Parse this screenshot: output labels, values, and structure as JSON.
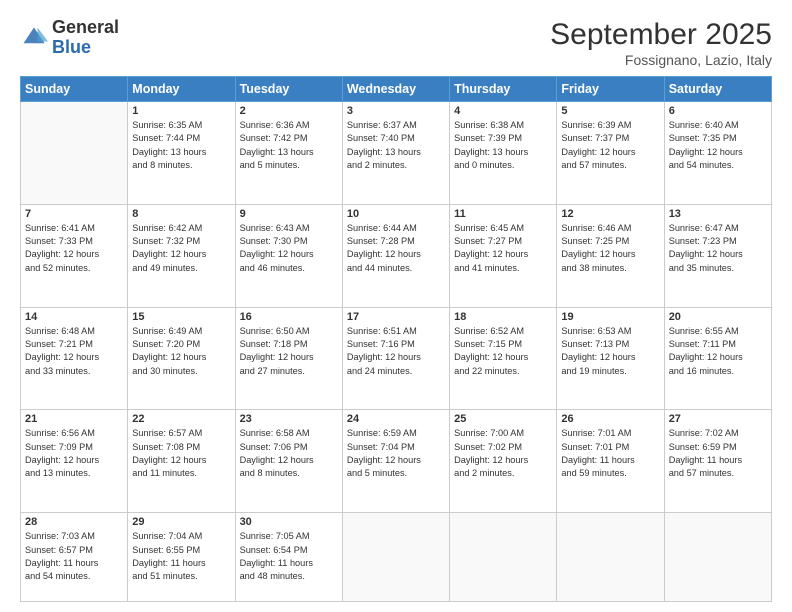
{
  "logo": {
    "general": "General",
    "blue": "Blue"
  },
  "title": "September 2025",
  "location": "Fossignano, Lazio, Italy",
  "days_of_week": [
    "Sunday",
    "Monday",
    "Tuesday",
    "Wednesday",
    "Thursday",
    "Friday",
    "Saturday"
  ],
  "weeks": [
    [
      {
        "day": "",
        "info": ""
      },
      {
        "day": "1",
        "info": "Sunrise: 6:35 AM\nSunset: 7:44 PM\nDaylight: 13 hours\nand 8 minutes."
      },
      {
        "day": "2",
        "info": "Sunrise: 6:36 AM\nSunset: 7:42 PM\nDaylight: 13 hours\nand 5 minutes."
      },
      {
        "day": "3",
        "info": "Sunrise: 6:37 AM\nSunset: 7:40 PM\nDaylight: 13 hours\nand 2 minutes."
      },
      {
        "day": "4",
        "info": "Sunrise: 6:38 AM\nSunset: 7:39 PM\nDaylight: 13 hours\nand 0 minutes."
      },
      {
        "day": "5",
        "info": "Sunrise: 6:39 AM\nSunset: 7:37 PM\nDaylight: 12 hours\nand 57 minutes."
      },
      {
        "day": "6",
        "info": "Sunrise: 6:40 AM\nSunset: 7:35 PM\nDaylight: 12 hours\nand 54 minutes."
      }
    ],
    [
      {
        "day": "7",
        "info": "Sunrise: 6:41 AM\nSunset: 7:33 PM\nDaylight: 12 hours\nand 52 minutes."
      },
      {
        "day": "8",
        "info": "Sunrise: 6:42 AM\nSunset: 7:32 PM\nDaylight: 12 hours\nand 49 minutes."
      },
      {
        "day": "9",
        "info": "Sunrise: 6:43 AM\nSunset: 7:30 PM\nDaylight: 12 hours\nand 46 minutes."
      },
      {
        "day": "10",
        "info": "Sunrise: 6:44 AM\nSunset: 7:28 PM\nDaylight: 12 hours\nand 44 minutes."
      },
      {
        "day": "11",
        "info": "Sunrise: 6:45 AM\nSunset: 7:27 PM\nDaylight: 12 hours\nand 41 minutes."
      },
      {
        "day": "12",
        "info": "Sunrise: 6:46 AM\nSunset: 7:25 PM\nDaylight: 12 hours\nand 38 minutes."
      },
      {
        "day": "13",
        "info": "Sunrise: 6:47 AM\nSunset: 7:23 PM\nDaylight: 12 hours\nand 35 minutes."
      }
    ],
    [
      {
        "day": "14",
        "info": "Sunrise: 6:48 AM\nSunset: 7:21 PM\nDaylight: 12 hours\nand 33 minutes."
      },
      {
        "day": "15",
        "info": "Sunrise: 6:49 AM\nSunset: 7:20 PM\nDaylight: 12 hours\nand 30 minutes."
      },
      {
        "day": "16",
        "info": "Sunrise: 6:50 AM\nSunset: 7:18 PM\nDaylight: 12 hours\nand 27 minutes."
      },
      {
        "day": "17",
        "info": "Sunrise: 6:51 AM\nSunset: 7:16 PM\nDaylight: 12 hours\nand 24 minutes."
      },
      {
        "day": "18",
        "info": "Sunrise: 6:52 AM\nSunset: 7:15 PM\nDaylight: 12 hours\nand 22 minutes."
      },
      {
        "day": "19",
        "info": "Sunrise: 6:53 AM\nSunset: 7:13 PM\nDaylight: 12 hours\nand 19 minutes."
      },
      {
        "day": "20",
        "info": "Sunrise: 6:55 AM\nSunset: 7:11 PM\nDaylight: 12 hours\nand 16 minutes."
      }
    ],
    [
      {
        "day": "21",
        "info": "Sunrise: 6:56 AM\nSunset: 7:09 PM\nDaylight: 12 hours\nand 13 minutes."
      },
      {
        "day": "22",
        "info": "Sunrise: 6:57 AM\nSunset: 7:08 PM\nDaylight: 12 hours\nand 11 minutes."
      },
      {
        "day": "23",
        "info": "Sunrise: 6:58 AM\nSunset: 7:06 PM\nDaylight: 12 hours\nand 8 minutes."
      },
      {
        "day": "24",
        "info": "Sunrise: 6:59 AM\nSunset: 7:04 PM\nDaylight: 12 hours\nand 5 minutes."
      },
      {
        "day": "25",
        "info": "Sunrise: 7:00 AM\nSunset: 7:02 PM\nDaylight: 12 hours\nand 2 minutes."
      },
      {
        "day": "26",
        "info": "Sunrise: 7:01 AM\nSunset: 7:01 PM\nDaylight: 11 hours\nand 59 minutes."
      },
      {
        "day": "27",
        "info": "Sunrise: 7:02 AM\nSunset: 6:59 PM\nDaylight: 11 hours\nand 57 minutes."
      }
    ],
    [
      {
        "day": "28",
        "info": "Sunrise: 7:03 AM\nSunset: 6:57 PM\nDaylight: 11 hours\nand 54 minutes."
      },
      {
        "day": "29",
        "info": "Sunrise: 7:04 AM\nSunset: 6:55 PM\nDaylight: 11 hours\nand 51 minutes."
      },
      {
        "day": "30",
        "info": "Sunrise: 7:05 AM\nSunset: 6:54 PM\nDaylight: 11 hours\nand 48 minutes."
      },
      {
        "day": "",
        "info": ""
      },
      {
        "day": "",
        "info": ""
      },
      {
        "day": "",
        "info": ""
      },
      {
        "day": "",
        "info": ""
      }
    ]
  ]
}
